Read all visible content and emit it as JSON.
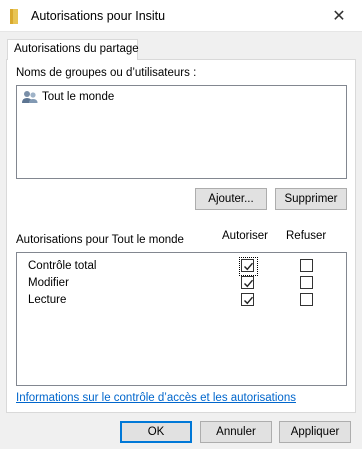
{
  "window": {
    "title": "Autorisations pour Insitu",
    "close_glyph": "✕",
    "folder_color": "#e8c454"
  },
  "tab": {
    "label": "Autorisations du partage"
  },
  "groups": {
    "label": "Noms de groupes ou d’utilisateurs :",
    "items": [
      {
        "name": "Tout le monde",
        "icon": "users-icon"
      }
    ]
  },
  "group_buttons": {
    "add": "Ajouter...",
    "remove": "Supprimer"
  },
  "permissions": {
    "label": "Autorisations pour Tout le monde",
    "allow_header": "Autoriser",
    "deny_header": "Refuser",
    "rows": [
      {
        "name": "Contrôle total",
        "allow": true,
        "deny": false
      },
      {
        "name": "Modifier",
        "allow": true,
        "deny": false
      },
      {
        "name": "Lecture",
        "allow": true,
        "deny": false
      }
    ]
  },
  "link": {
    "text": "Informations sur le contrôle d’accès et les autorisations"
  },
  "footer": {
    "ok": "OK",
    "cancel": "Annuler",
    "apply": "Appliquer"
  }
}
